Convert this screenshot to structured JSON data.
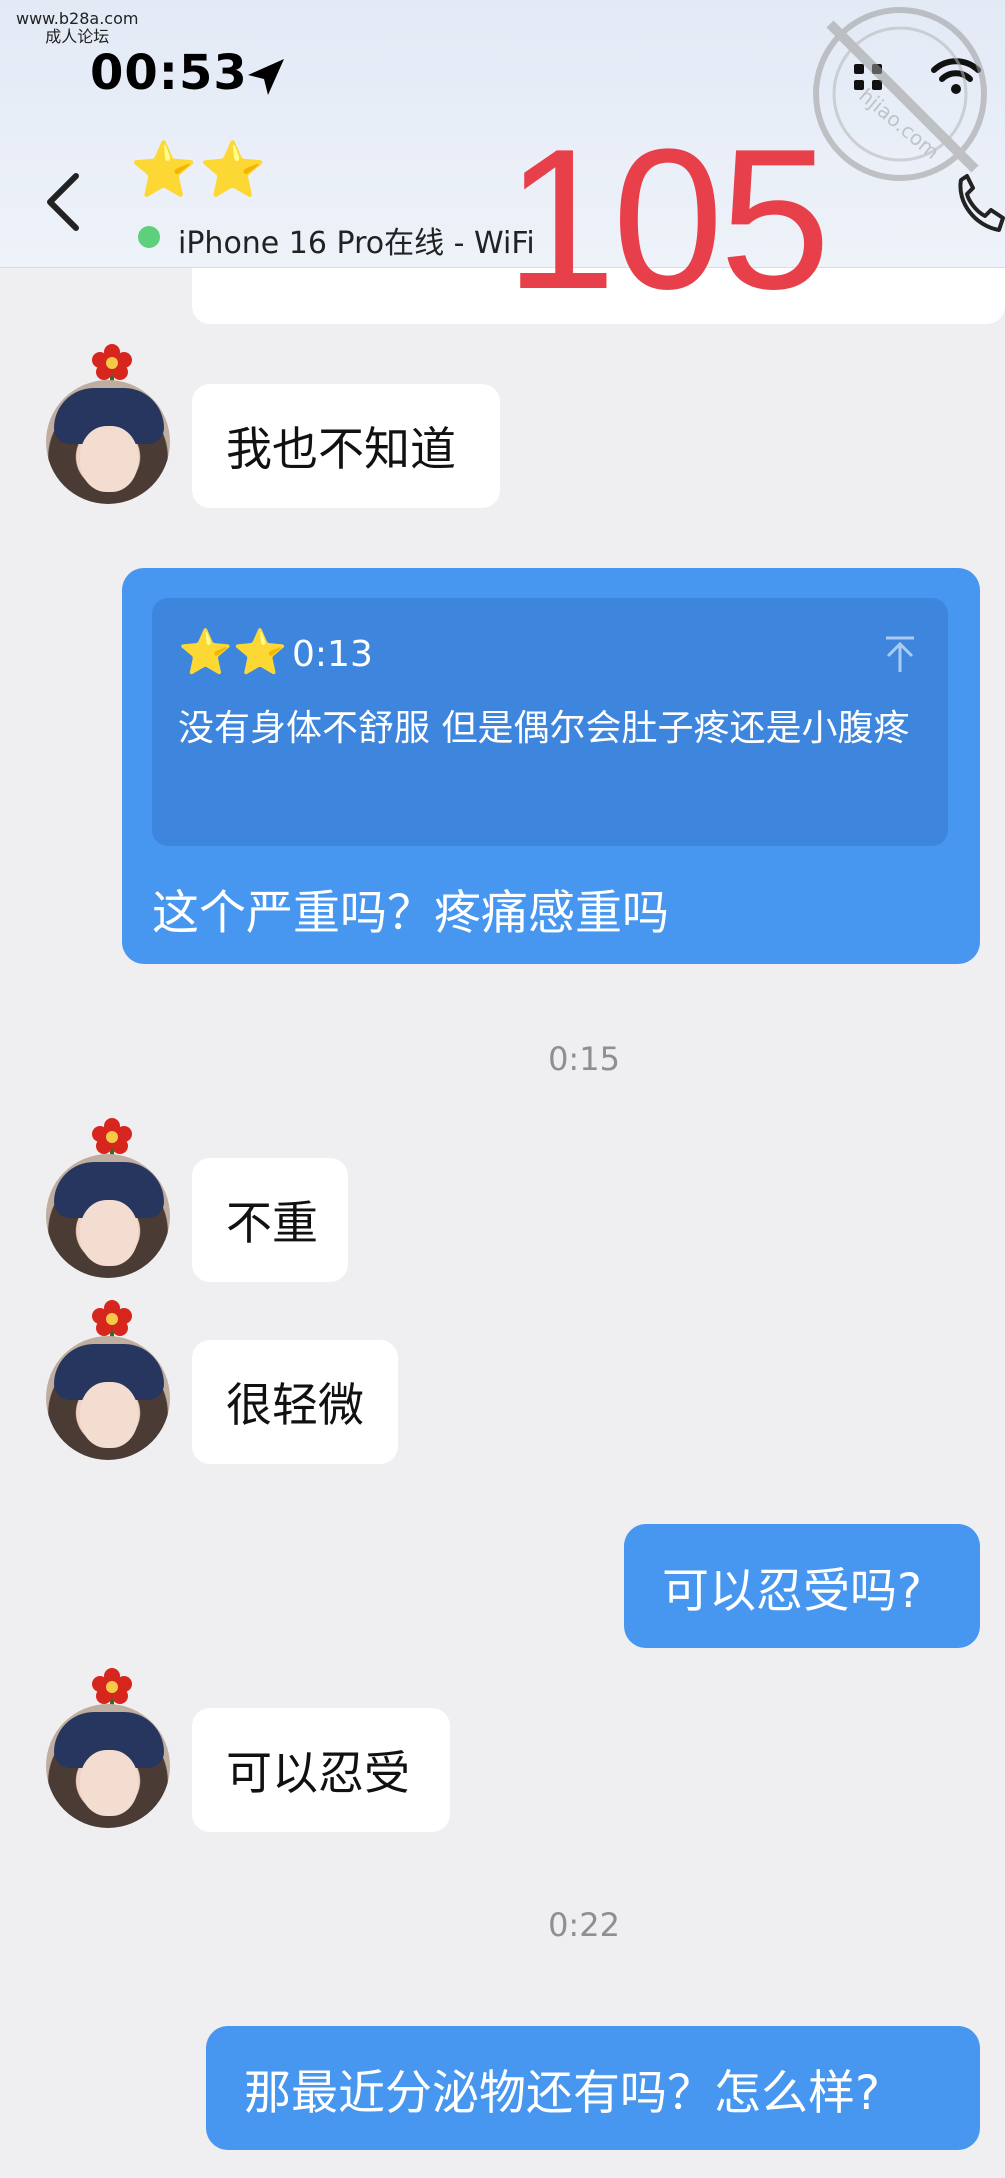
{
  "watermark": {
    "site": "www.b28a.com",
    "site_sub": "成人论坛"
  },
  "status_bar": {
    "time": "00:53"
  },
  "header": {
    "stars": "⭐⭐",
    "presence": "iPhone 16 Pro在线 - WiFi",
    "overlay_number": "105"
  },
  "messages": {
    "m1": "我也不知道",
    "quote_stars": "⭐⭐",
    "quote_time": "0:13",
    "quote_text": "没有身体不舒服 但是偶尔会肚子疼还是小腹疼",
    "m2": "这个严重吗？疼痛感重吗",
    "t1": "0:15",
    "m3": "不重",
    "m4": "很轻微",
    "m5": "可以忍受吗?",
    "m6": "可以忍受",
    "t2": "0:22",
    "m7": "那最近分泌物还有吗？怎么样?"
  },
  "colors": {
    "outgoing_bubble": "#4796f0",
    "quote_block": "#3e86dd",
    "overlay_number": "#e8404a",
    "online_dot": "#5cd07a"
  }
}
